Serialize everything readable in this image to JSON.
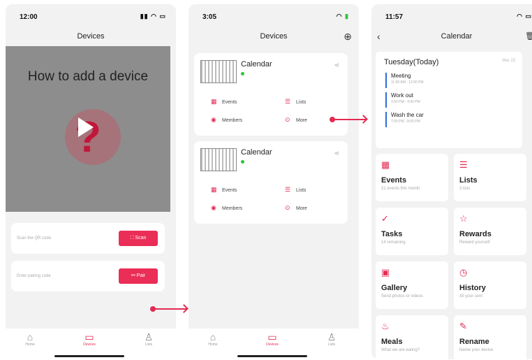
{
  "phone1": {
    "time": "12:00",
    "title": "Devices",
    "video_title": "How to add a device",
    "scan_placeholder": "Scan the QR code",
    "scan_button": "Scan",
    "pair_placeholder": "Enter pairing code",
    "pair_button": "Pair",
    "tabs": [
      "Home",
      "Devices",
      "Lists"
    ]
  },
  "phone2": {
    "time": "3:05",
    "title": "Devices",
    "devices": [
      {
        "name": "Calendar",
        "menu": [
          "Events",
          "Lists",
          "Members",
          "More"
        ]
      },
      {
        "name": "Calendar",
        "menu": [
          "Events",
          "Lists",
          "Members",
          "More"
        ]
      }
    ],
    "tabs": [
      "Home",
      "Devices",
      "Lists"
    ]
  },
  "phone3": {
    "time": "11:57",
    "title": "Calendar",
    "day_header": "Tuesday(Today)",
    "day_date": "Mar 23",
    "events": [
      {
        "name": "Meeting",
        "time": "11:00 AM - 12:00 PM"
      },
      {
        "name": "Work out",
        "time": "3:00 PM - 4:00 PM"
      },
      {
        "name": "Wash the car",
        "time": "7:00 PM - 8:00 PM"
      }
    ],
    "tiles": [
      {
        "icon": "calendar-icon",
        "title": "Events",
        "sub": "21 events this month"
      },
      {
        "icon": "list-icon",
        "title": "Lists",
        "sub": "3 lists"
      },
      {
        "icon": "tasks-icon",
        "title": "Tasks",
        "sub": "14 remaining"
      },
      {
        "icon": "star-icon",
        "title": "Rewards",
        "sub": "Reward yourself"
      },
      {
        "icon": "image-icon",
        "title": "Gallery",
        "sub": "Send photos or videos"
      },
      {
        "icon": "clock-icon",
        "title": "History",
        "sub": "All your sent"
      },
      {
        "icon": "meal-icon",
        "title": "Meals",
        "sub": "What we are eating?"
      },
      {
        "icon": "edit-icon",
        "title": "Rename",
        "sub": "Name your device"
      }
    ]
  },
  "colors": {
    "accent": "#e32a52",
    "online": "#2ec43b",
    "event_bar": "#2c6bd6"
  }
}
